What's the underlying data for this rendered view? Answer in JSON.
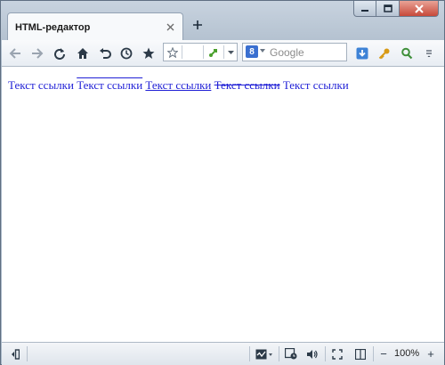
{
  "window": {
    "tab_title": "HTML-редактор"
  },
  "toolbar": {
    "search_placeholder": "Google",
    "search_engine_letter": "8"
  },
  "content": {
    "links": [
      {
        "text": "Текст ссылки",
        "style": "none"
      },
      {
        "text": "Текст ссылки",
        "style": "overline"
      },
      {
        "text": "Текст ссылки",
        "style": "underline"
      },
      {
        "text": "Текст ссылки",
        "style": "line-through"
      },
      {
        "text": "Текст ссылки",
        "style": "none"
      }
    ]
  },
  "statusbar": {
    "zoom": "100%",
    "zoom_out": "−",
    "zoom_in": "+"
  },
  "colors": {
    "link": "#1f1fd6",
    "close_button": "#c7493a"
  }
}
